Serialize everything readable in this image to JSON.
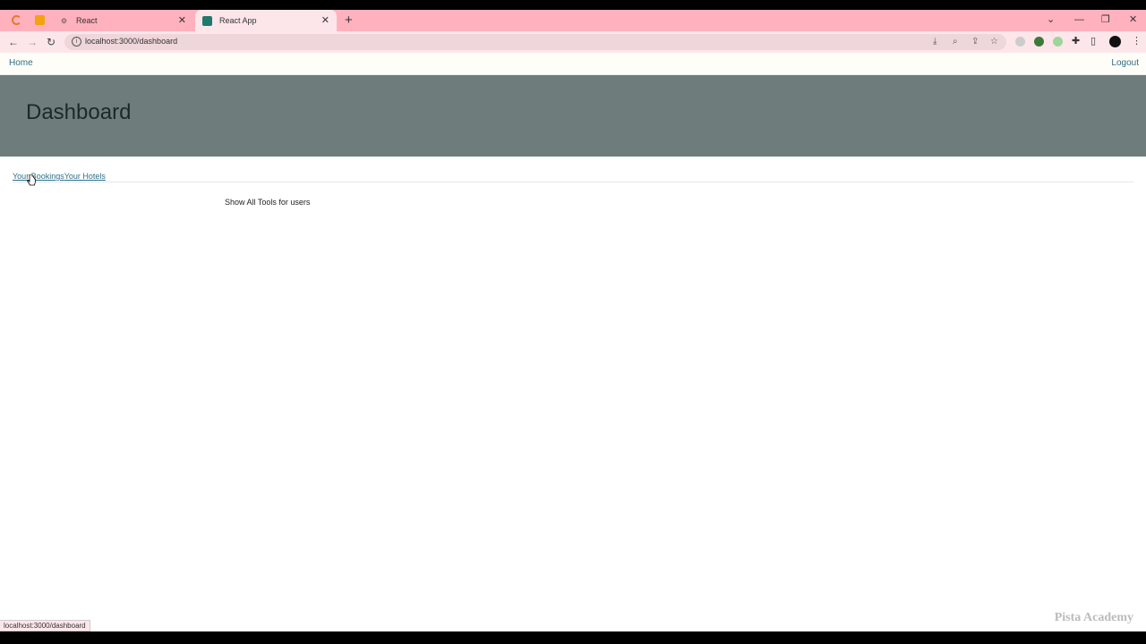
{
  "browser": {
    "tabs": [
      {
        "title": "React",
        "active": false
      },
      {
        "title": "React App",
        "active": true
      }
    ],
    "new_tab_glyph": "+",
    "close_glyph": "✕",
    "address": "localhost:3000/dashboard",
    "status_url": "localhost:3000/dashboard"
  },
  "app": {
    "nav": {
      "home": "Home",
      "logout": "Logout"
    },
    "page_title": "Dashboard",
    "subnav": {
      "bookings": "Your Bookings",
      "hotels": "Your Hotels"
    },
    "message": "Show All Tools for users"
  },
  "watermark": "Pista Academy",
  "colors": {
    "tabstrip": "#ffb1bd",
    "hero": "#6e7d7b",
    "link": "#2f6f87"
  }
}
